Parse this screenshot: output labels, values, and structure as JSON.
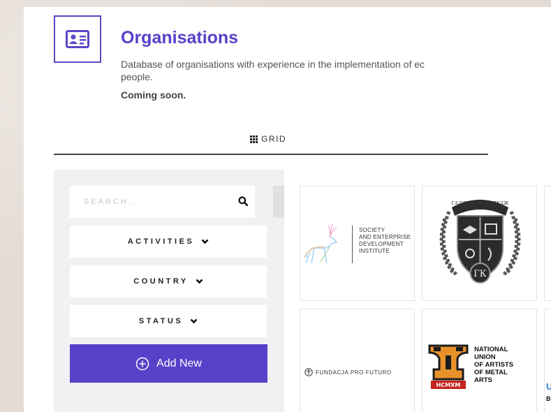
{
  "header": {
    "title": "Organisations",
    "description_line1": "Database of organisations with experience in the implementation of ec",
    "description_line2": "people.",
    "coming_soon": "Coming soon."
  },
  "view_tab": {
    "label": "GRID",
    "icon": "grid-icon"
  },
  "sidebar": {
    "search_placeholder": "SEARCH...",
    "filters": [
      {
        "label": "ACTIVITIES"
      },
      {
        "label": "COUNTRY"
      },
      {
        "label": "STATUS"
      }
    ],
    "add_new_label": "Add New"
  },
  "cards": {
    "sedi": {
      "line1": "SOCIETY",
      "line2": "AND ENTERPRISE",
      "line3": "DEVELOPMENT",
      "line4": "INSTITUTE"
    },
    "futuro": {
      "label": "FUNDACJA PRO FUTURO"
    },
    "nuam": {
      "line1": "NATIONAL",
      "line2": "UNION",
      "line3": "OF ARTISTS",
      "line4": "OF METAL",
      "line5": "ARTS",
      "badge": "НСМХМ"
    },
    "college": {
      "arc": "ГАЛИЦЬКИЙ КОЛЕДЖ",
      "monogram": "ГК"
    },
    "partial": {
      "letter_top": "U",
      "letter_bottom": "B"
    }
  },
  "colors": {
    "accent": "#5641c9",
    "panel_bg": "#f1f1f3"
  }
}
